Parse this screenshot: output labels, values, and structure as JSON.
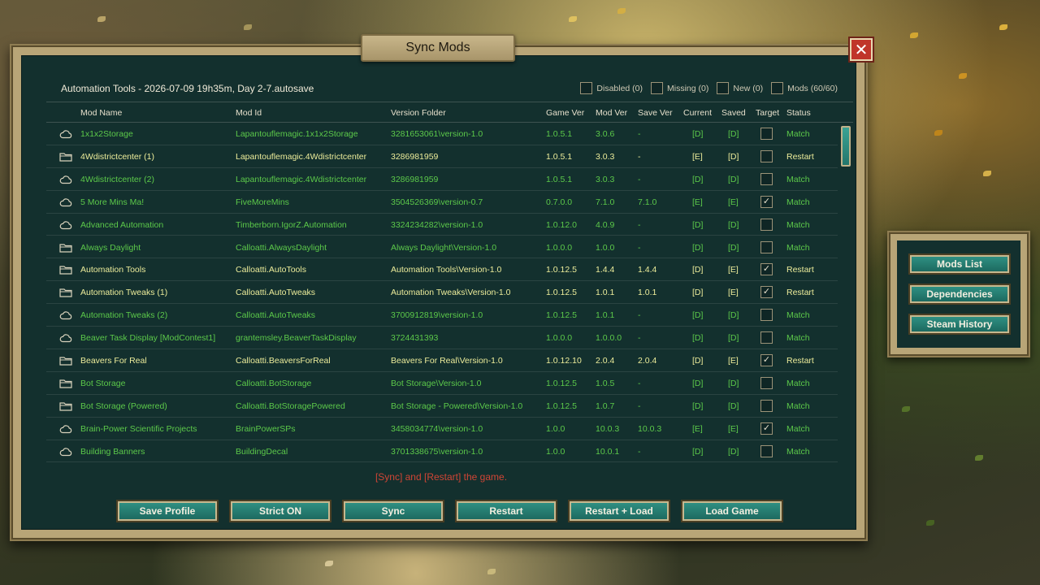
{
  "dialog": {
    "title": "Sync Mods",
    "close_glyph": "✕",
    "save_name": "Automation Tools - 2026-07-09 19h35m, Day 2-7.autosave",
    "filters": [
      {
        "label": "Disabled (0)",
        "checked": false
      },
      {
        "label": "Missing (0)",
        "checked": false
      },
      {
        "label": "New (0)",
        "checked": false
      },
      {
        "label": "Mods (60/60)",
        "checked": false
      }
    ],
    "columns": {
      "name": "Mod Name",
      "id": "Mod Id",
      "folder": "Version Folder",
      "game_ver": "Game Ver",
      "mod_ver": "Mod Ver",
      "save_ver": "Save Ver",
      "current": "Current",
      "saved": "Saved",
      "target": "Target",
      "status": "Status"
    },
    "rows": [
      {
        "icon": "cloud-icon",
        "name": "1x1x2Storage",
        "id": "Lapantouflemagic.1x1x2Storage",
        "folder": "3281653061\\version-1.0",
        "game_ver": "1.0.5.1",
        "mod_ver": "3.0.6",
        "save_ver": "-",
        "current": "[D]",
        "saved": "[D]",
        "target": false,
        "status": "Match"
      },
      {
        "icon": "folder-icon",
        "name": "4Wdistrictcenter (1)",
        "id": "Lapantouflemagic.4Wdistrictcenter",
        "folder": "3286981959",
        "game_ver": "1.0.5.1",
        "mod_ver": "3.0.3",
        "save_ver": "-",
        "current": "[E]",
        "saved": "[D]",
        "target": false,
        "status": "Restart"
      },
      {
        "icon": "cloud-icon",
        "name": "4Wdistrictcenter (2)",
        "id": "Lapantouflemagic.4Wdistrictcenter",
        "folder": "3286981959",
        "game_ver": "1.0.5.1",
        "mod_ver": "3.0.3",
        "save_ver": "-",
        "current": "[D]",
        "saved": "[D]",
        "target": false,
        "status": "Match"
      },
      {
        "icon": "cloud-icon",
        "name": "5 More Mins Ma!",
        "id": "FiveMoreMins",
        "folder": "3504526369\\version-0.7",
        "game_ver": "0.7.0.0",
        "mod_ver": "7.1.0",
        "save_ver": "7.1.0",
        "current": "[E]",
        "saved": "[E]",
        "target": true,
        "status": "Match"
      },
      {
        "icon": "cloud-icon",
        "name": "Advanced Automation",
        "id": "Timberborn.IgorZ.Automation",
        "folder": "3324234282\\version-1.0",
        "game_ver": "1.0.12.0",
        "mod_ver": "4.0.9",
        "save_ver": "-",
        "current": "[D]",
        "saved": "[D]",
        "target": false,
        "status": "Match"
      },
      {
        "icon": "folder-icon",
        "name": "Always Daylight",
        "id": "Calloatti.AlwaysDaylight",
        "folder": "Always Daylight\\Version-1.0",
        "game_ver": "1.0.0.0",
        "mod_ver": "1.0.0",
        "save_ver": "-",
        "current": "[D]",
        "saved": "[D]",
        "target": false,
        "status": "Match"
      },
      {
        "icon": "folder-icon",
        "name": "Automation Tools",
        "id": "Calloatti.AutoTools",
        "folder": "Automation Tools\\Version-1.0",
        "game_ver": "1.0.12.5",
        "mod_ver": "1.4.4",
        "save_ver": "1.4.4",
        "current": "[D]",
        "saved": "[E]",
        "target": true,
        "status": "Restart"
      },
      {
        "icon": "folder-icon",
        "name": "Automation Tweaks (1)",
        "id": "Calloatti.AutoTweaks",
        "folder": "Automation Tweaks\\Version-1.0",
        "game_ver": "1.0.12.5",
        "mod_ver": "1.0.1",
        "save_ver": "1.0.1",
        "current": "[D]",
        "saved": "[E]",
        "target": true,
        "status": "Restart"
      },
      {
        "icon": "cloud-icon",
        "name": "Automation Tweaks (2)",
        "id": "Calloatti.AutoTweaks",
        "folder": "3700912819\\version-1.0",
        "game_ver": "1.0.12.5",
        "mod_ver": "1.0.1",
        "save_ver": "-",
        "current": "[D]",
        "saved": "[D]",
        "target": false,
        "status": "Match"
      },
      {
        "icon": "cloud-icon",
        "name": "Beaver Task Display [ModContest1]",
        "id": "grantemsley.BeaverTaskDisplay",
        "folder": "3724431393",
        "game_ver": "1.0.0.0",
        "mod_ver": "1.0.0.0",
        "save_ver": "-",
        "current": "[D]",
        "saved": "[D]",
        "target": false,
        "status": "Match"
      },
      {
        "icon": "folder-icon",
        "name": "Beavers For Real",
        "id": "Calloatti.BeaversForReal",
        "folder": "Beavers For Real\\Version-1.0",
        "game_ver": "1.0.12.10",
        "mod_ver": "2.0.4",
        "save_ver": "2.0.4",
        "current": "[D]",
        "saved": "[E]",
        "target": true,
        "status": "Restart"
      },
      {
        "icon": "folder-icon",
        "name": "Bot Storage",
        "id": "Calloatti.BotStorage",
        "folder": "Bot Storage\\Version-1.0",
        "game_ver": "1.0.12.5",
        "mod_ver": "1.0.5",
        "save_ver": "-",
        "current": "[D]",
        "saved": "[D]",
        "target": false,
        "status": "Match"
      },
      {
        "icon": "folder-icon",
        "name": "Bot Storage (Powered)",
        "id": "Calloatti.BotStoragePowered",
        "folder": "Bot Storage - Powered\\Version-1.0",
        "game_ver": "1.0.12.5",
        "mod_ver": "1.0.7",
        "save_ver": "-",
        "current": "[D]",
        "saved": "[D]",
        "target": false,
        "status": "Match"
      },
      {
        "icon": "cloud-icon",
        "name": "Brain-Power Scientific Projects",
        "id": "BrainPowerSPs",
        "folder": "3458034774\\version-1.0",
        "game_ver": "1.0.0",
        "mod_ver": "10.0.3",
        "save_ver": "10.0.3",
        "current": "[E]",
        "saved": "[E]",
        "target": true,
        "status": "Match"
      },
      {
        "icon": "cloud-icon",
        "name": "Building Banners",
        "id": "BuildingDecal",
        "folder": "3701338675\\version-1.0",
        "game_ver": "1.0.0",
        "mod_ver": "10.0.1",
        "save_ver": "-",
        "current": "[D]",
        "saved": "[D]",
        "target": false,
        "status": "Match"
      }
    ],
    "hint": "[Sync] and [Restart] the game.",
    "buttons": {
      "save_profile": "Save Profile",
      "strict": "Strict ON",
      "sync": "Sync",
      "restart": "Restart",
      "restart_load": "Restart + Load",
      "load_game": "Load Game"
    }
  },
  "side_menu": {
    "mods_list": "Mods List",
    "dependencies": "Dependencies",
    "steam_history": "Steam History"
  },
  "colors": {
    "match_text": "#5cc94a",
    "restart_text": "#ecec9a",
    "hint_text": "#d04535",
    "panel_bg": "#13302e",
    "button_bg": "#1d6a60"
  }
}
